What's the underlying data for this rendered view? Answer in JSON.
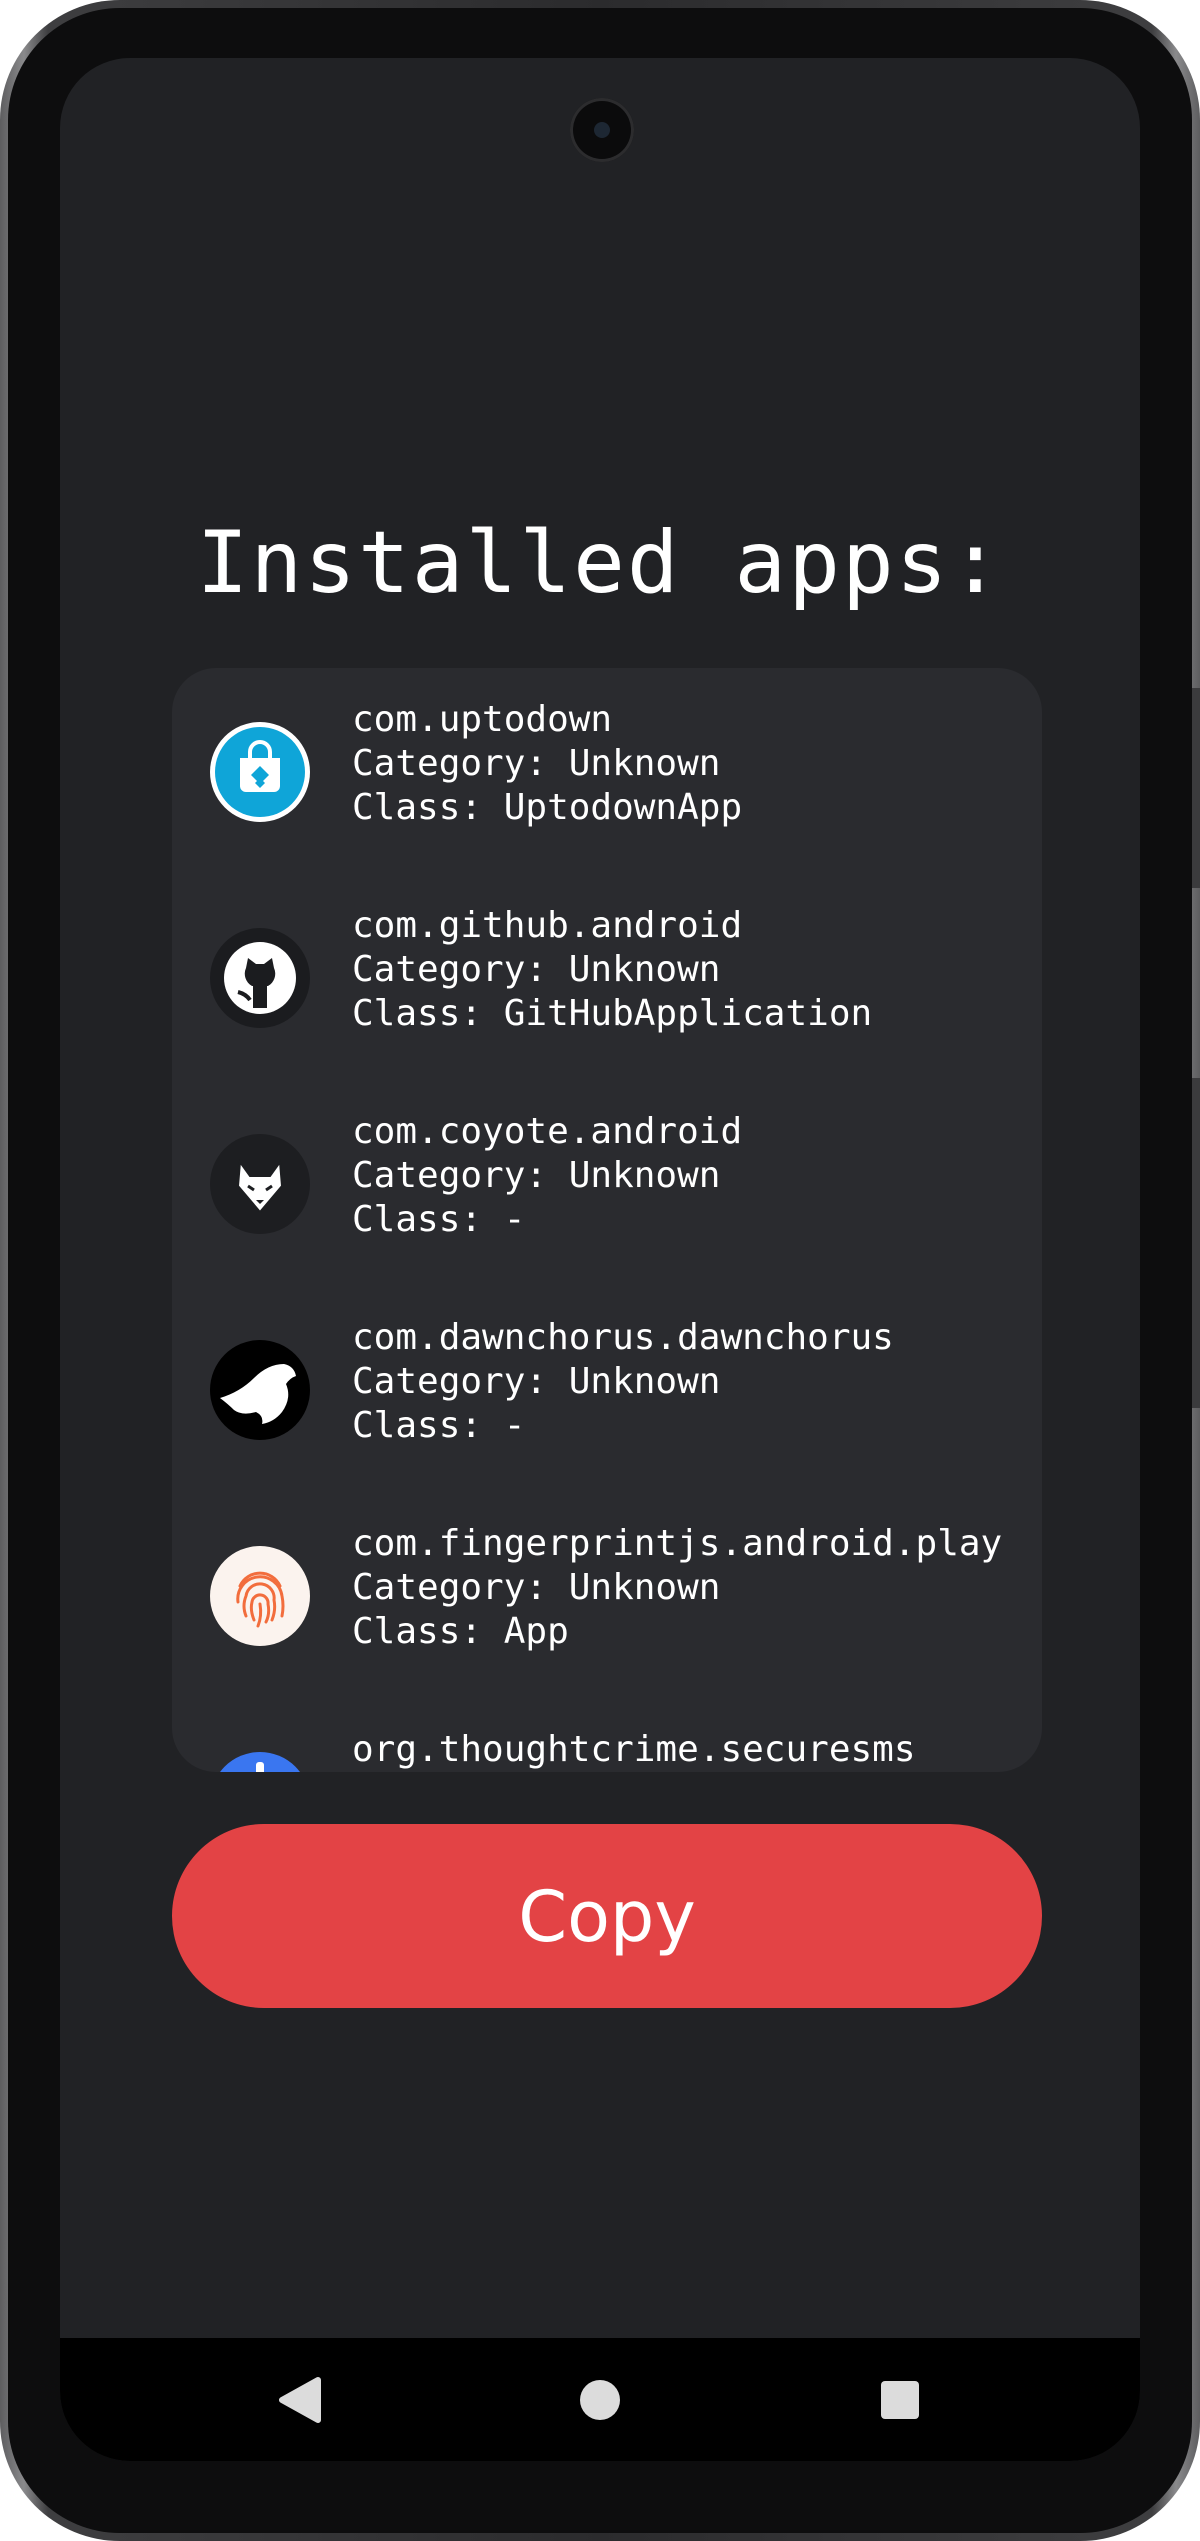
{
  "title": "Installed apps:",
  "apps": [
    {
      "package": "com.uptodown",
      "category": "Category: Unknown",
      "class": "Class: UptodownApp",
      "icon": "uptodown-icon"
    },
    {
      "package": "com.github.android",
      "category": "Category: Unknown",
      "class": "Class: GitHubApplication",
      "icon": "github-icon"
    },
    {
      "package": "com.coyote.android",
      "category": "Category: Unknown",
      "class": "Class: -",
      "icon": "coyote-icon"
    },
    {
      "package": "com.dawnchorus.dawnchorus",
      "category": "Category: Unknown",
      "class": "Class: -",
      "icon": "dawnchorus-bird-icon"
    },
    {
      "package": "com.fingerprintjs.android.play",
      "category": "Category: Unknown",
      "class": "Class: App",
      "icon": "fingerprint-icon"
    },
    {
      "package": "org.thoughtcrime.securesms",
      "category": "",
      "class": "",
      "icon": "signal-icon"
    }
  ],
  "copy_button": {
    "label": "Copy"
  },
  "colors": {
    "background": "#212225",
    "card": "#2a2b2f",
    "accent": "#e34345",
    "text": "#ffffff"
  },
  "nav": {
    "back": "back-icon",
    "home": "home-icon",
    "recents": "recents-icon"
  }
}
